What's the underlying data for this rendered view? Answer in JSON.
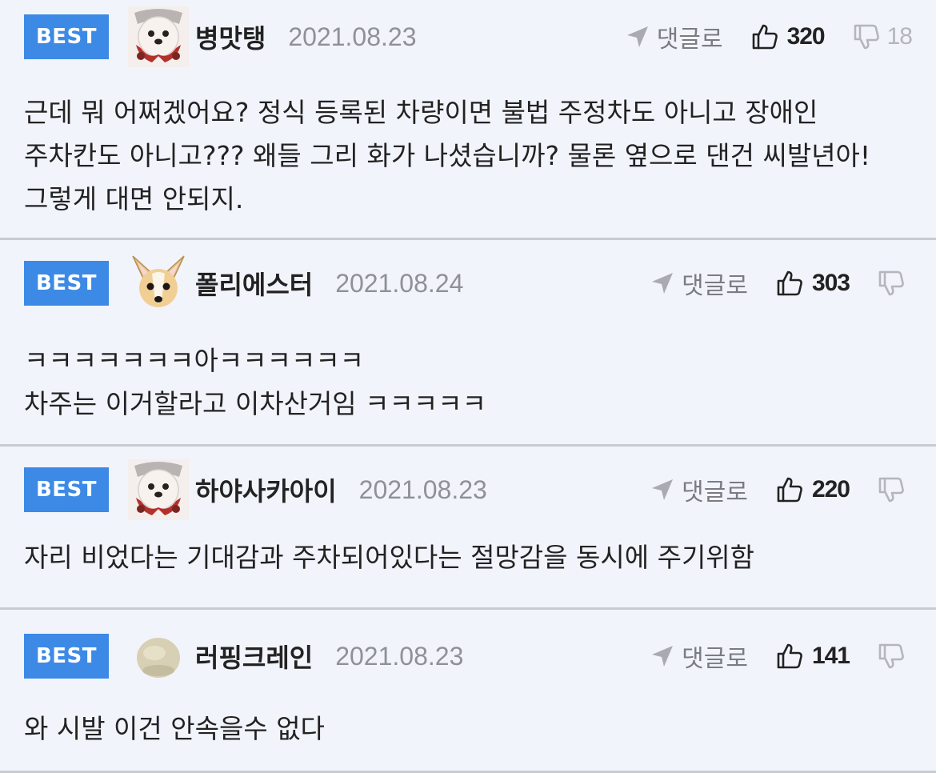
{
  "badge_label": "BEST",
  "reply_label": "댓글로",
  "colors": {
    "badge_bg": "#3c8ae6",
    "page_bg": "#f2f4fc",
    "divider": "#c9cbd2",
    "date_text": "#8f9196",
    "dislike_text": "#b4b6bb"
  },
  "comments": [
    {
      "nickname": "병맛탱",
      "date": "2021.08.23",
      "likes": "320",
      "dislikes": "18",
      "avatar": "panda-dog-avatar",
      "text": "근데 뭐 어쩌겠어요? 정식 등록된 차량이면 불법 주정차도 아니고 장애인 주차칸도 아니고??? 왜들 그리 화가 나셨습니까? 물론 옆으로 댄건 씨발년아! 그렇게 대면 안되지."
    },
    {
      "nickname": "폴리에스터",
      "date": "2021.08.24",
      "likes": "303",
      "dislikes": "",
      "avatar": "chihuahua-avatar",
      "text": "ㅋㅋㅋㅋㅋㅋㅋ아ㅋㅋㅋㅋㅋㅋ\n차주는 이거할라고 이차산거임 ㅋㅋㅋㅋㅋ"
    },
    {
      "nickname": "하야사카아이",
      "date": "2021.08.23",
      "likes": "220",
      "dislikes": "",
      "avatar": "panda-dog-avatar",
      "text": "자리 비었다는 기대감과 주차되어있다는 절망감을 동시에 주기위함"
    },
    {
      "nickname": "러핑크레인",
      "date": "2021.08.23",
      "likes": "141",
      "dislikes": "",
      "avatar": "blob-avatar",
      "text": "와 시발 이건 안속을수 없다"
    }
  ]
}
